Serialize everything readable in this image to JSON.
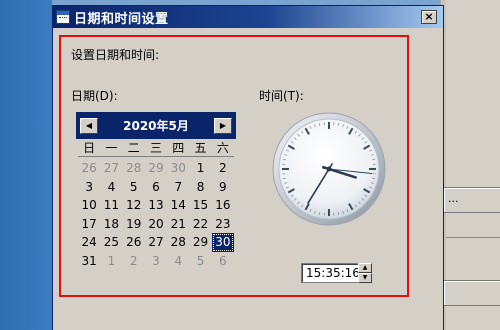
{
  "dialog": {
    "title": "日期和时间设置",
    "close": "×",
    "group_label": "设置日期和时间:",
    "date_label": "日期(D):",
    "time_label": "时间(T):"
  },
  "calendar": {
    "month_label": "2020年5月",
    "prev": "◀",
    "next": "▶",
    "weekdays": [
      "日",
      "一",
      "二",
      "三",
      "四",
      "五",
      "六"
    ],
    "days": [
      [
        "26",
        "27",
        "28",
        "29",
        "30",
        "1",
        "2"
      ],
      [
        "3",
        "4",
        "5",
        "6",
        "7",
        "8",
        "9"
      ],
      [
        "10",
        "11",
        "12",
        "13",
        "14",
        "15",
        "16"
      ],
      [
        "17",
        "18",
        "19",
        "20",
        "21",
        "22",
        "23"
      ],
      [
        "24",
        "25",
        "26",
        "27",
        "28",
        "29",
        "30"
      ],
      [
        "31",
        "1",
        "2",
        "3",
        "4",
        "5",
        "6"
      ]
    ],
    "selected_day": "30"
  },
  "clock": {
    "time_value": "15:35:16",
    "spin_up": "▲",
    "spin_down": "▼"
  },
  "background": {
    "button_1": "..."
  }
}
